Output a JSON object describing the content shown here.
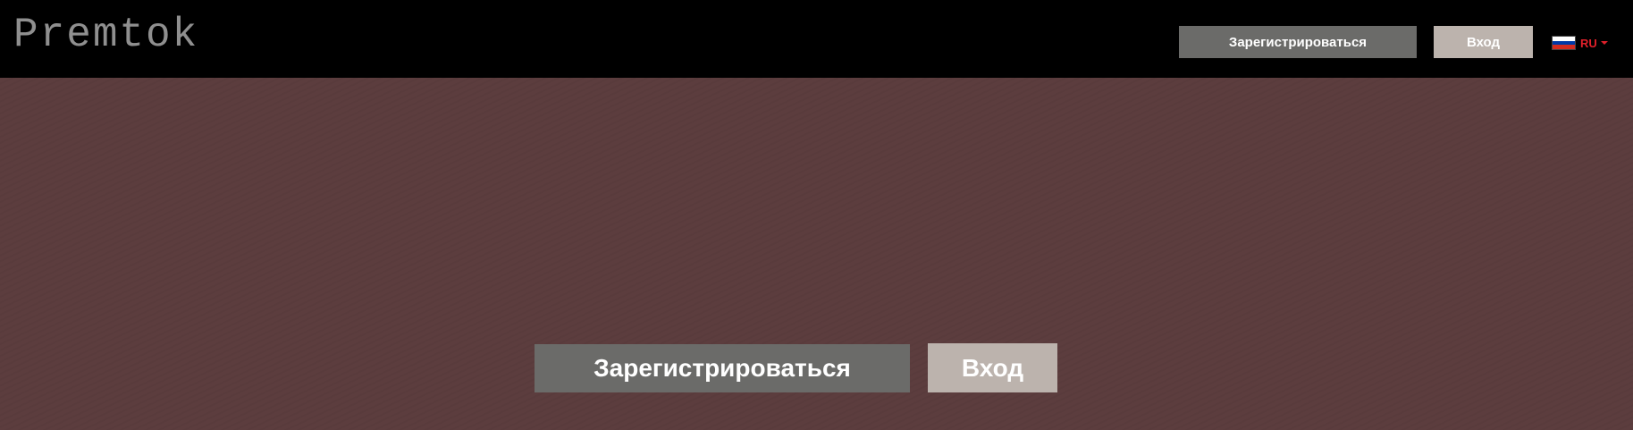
{
  "header": {
    "logo": "Premtok",
    "register_label": "Зарегистрироваться",
    "login_label": "Вход",
    "language": {
      "code": "RU",
      "flag_icon": "russia-flag-icon",
      "flag_colors": [
        "#ffffff",
        "#0039a6",
        "#d52b1e"
      ],
      "code_color": "#e0202a"
    }
  },
  "hero": {
    "register_label": "Зарегистрироваться",
    "login_label": "Вход"
  },
  "colors": {
    "topbar": "#000000",
    "background": "#5c3d3e",
    "register_button": "#6b6b69",
    "login_button": "#bcb3ad"
  }
}
